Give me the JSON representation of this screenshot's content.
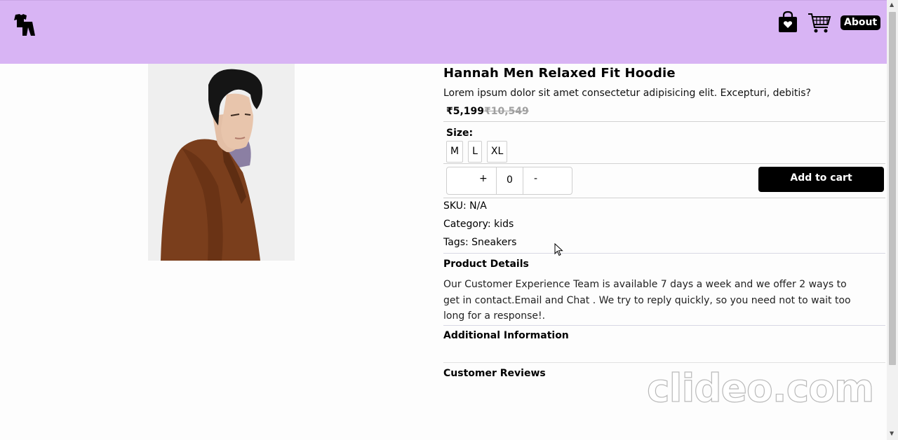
{
  "header": {
    "logo_icon": "clothes-icon",
    "nav": {
      "bag_icon": "shopping-bag-heart-icon",
      "cart_icon": "shopping-cart-icon",
      "about_label": "About"
    },
    "background_color": "#d8b4f4"
  },
  "product": {
    "title": "Hannah Men Relaxed Fit Hoodie",
    "description": "Lorem ipsum dolor sit amet consectetur adipisicing elit. Excepturi, debitis?",
    "price": "₹5,199",
    "old_price": "₹10,549",
    "size_label": "Size:",
    "sizes": [
      "M",
      "L",
      "XL"
    ],
    "quantity": {
      "plus_label": "+",
      "value": "0",
      "minus_label": "-"
    },
    "add_to_cart_label": "Add to cart",
    "sku": "SKU: N/A",
    "category": "Category: kids",
    "tags": "Tags: Sneakers",
    "details_title": "Product Details",
    "details_body": "Our Customer Experience Team is available 7 days a week and we offer 2 ways to get in contact.Email and Chat . We try to reply quickly, so you need not to wait too long for a response!.",
    "additional_title": "Additional Information",
    "reviews_title": "Customer Reviews"
  },
  "watermark": "clideo.com"
}
